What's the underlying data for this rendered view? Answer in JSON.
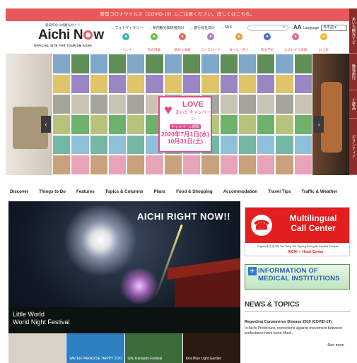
{
  "alert": "新型コロナウイルス（COVID-19）にご注意ください。詳しくはこちら。",
  "side_tabs": [
    "あいち観光ナビ",
    "教育旅行",
    "土産品",
    "ボランティア"
  ],
  "header": {
    "logo_sub": "愛知県の公式観光ガイド",
    "logo_main_pre": "Aichi N",
    "logo_main_post": "w",
    "logo_tagline": "OFFICIAL SITE FOR TOURISM AICHI",
    "quick_links": [
      "→ フォトギャラリー",
      "→ 県内観光関係者向け",
      "→ 旅行会社向け",
      "→ SNS"
    ],
    "search_placeholder": "",
    "lang_a": "AA",
    "lang_label": "Language",
    "lang_value": "日本語"
  },
  "categories": [
    {
      "label": "イベント",
      "color": "#3fb8a8"
    },
    {
      "label": "旬の特集",
      "color": "#6cbf4b"
    },
    {
      "label": "観光＆体験",
      "color": "#e2695c"
    },
    {
      "label": "コースガイド",
      "color": "#b57ac6"
    },
    {
      "label": "食べる・買う",
      "color": "#f19b3c"
    },
    {
      "label": "宿泊予約",
      "color": "#4a6fc2"
    },
    {
      "label": "まるわかり情報",
      "color": "#e06f8d"
    },
    {
      "label": "お土産",
      "color": "#f3b53e"
    }
  ],
  "hero": {
    "love_title": "LOVE",
    "love_sub": "あいち キャンペーン",
    "love_tag": "キャンペーン期間",
    "love_date1": "2020年7月1日(水)",
    "love_date2": "10月31日(土)",
    "arrow_left": "‹",
    "arrow_right": "›"
  },
  "main_nav": [
    "Discover",
    "Things to Do",
    "Features",
    "Topics & Columns",
    "Plans",
    "Food & Shopping",
    "Accommodation",
    "Travel Tips",
    "Traffic & Weather"
  ],
  "feature": {
    "title": "AICHI RIGHT NOW!!",
    "caption_line1": "Little World",
    "caption_line2": "World Night Festival"
  },
  "thumbs": [
    {
      "label": "",
      "color": "#d9d2c4"
    },
    {
      "label": "WATER PARADISE HAPPY ZOO",
      "color": "#2d7fbf"
    },
    {
      "label": "Gifu Kanaami Festival",
      "color": "#3c6b3a"
    },
    {
      "label": "Kira Blue Light Garden",
      "color": "#2a1a10"
    }
  ],
  "call_center": {
    "title_line1": "Multilingual",
    "title_line2": "Call Center",
    "langs": "English 中文 한국어 ไทย Tiếng Việt Tagalog Português Español Français",
    "logo": "AICHI ✓ Heart Center"
  },
  "medical": {
    "title_line1": "INFORMATION OF",
    "title_line2": "MEDICAL INSTITUTIONS"
  },
  "news": {
    "heading": "NEWS & TOPICS",
    "item_title": "Regarding Coronavirus Disease 2019 (COVID-19)",
    "item_body": "In Aichi Prefecture, restrictions against movement between prefectures have been lifted...",
    "see_more": "›See more"
  }
}
